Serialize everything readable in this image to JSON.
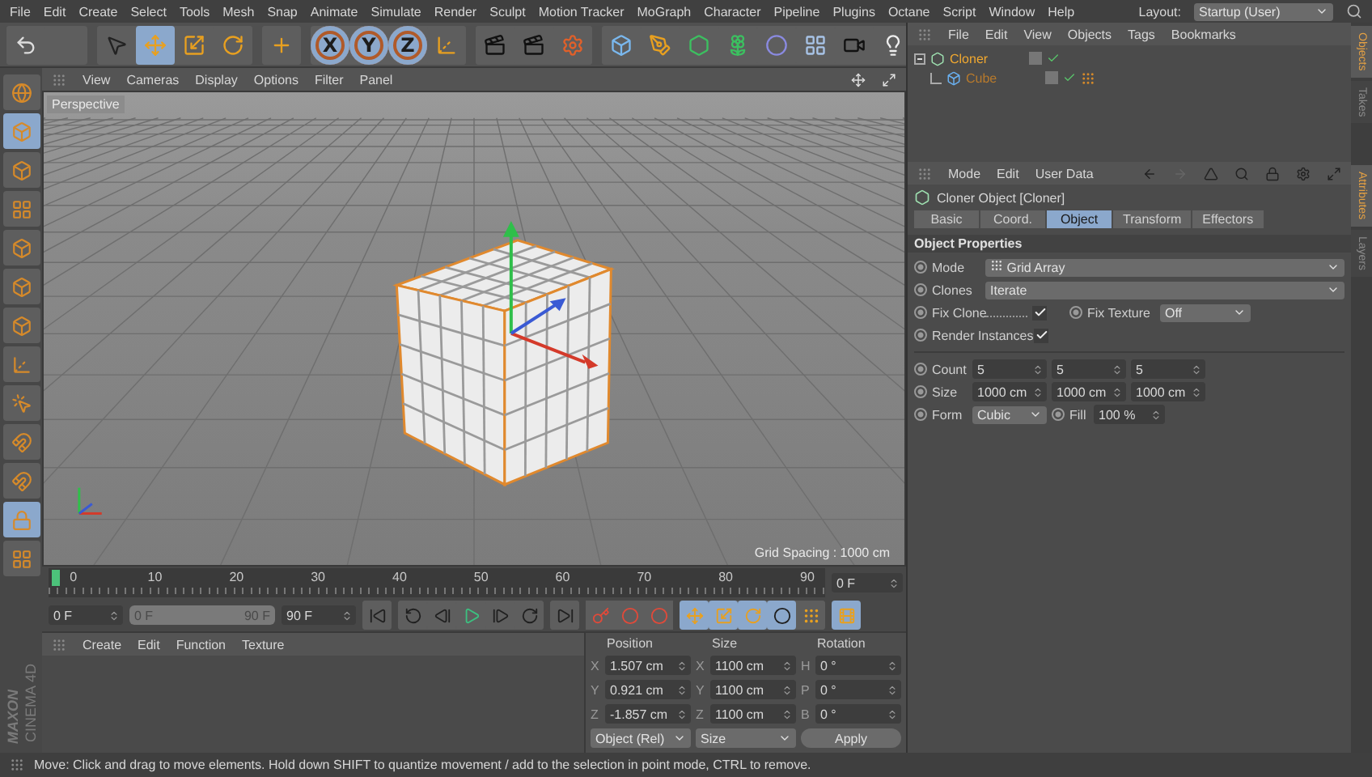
{
  "menu_bar": {
    "items": [
      "File",
      "Edit",
      "Create",
      "Select",
      "Tools",
      "Mesh",
      "Snap",
      "Animate",
      "Simulate",
      "Render",
      "Sculpt",
      "Motion Tracker",
      "MoGraph",
      "Character",
      "Pipeline",
      "Plugins",
      "Octane",
      "Script",
      "Window",
      "Help"
    ],
    "layout_label": "Layout:",
    "layout_value": "Startup (User)"
  },
  "toolbar": {
    "tools": [
      {
        "selected": false
      },
      {
        "selected": true
      },
      {
        "selected": false
      },
      {
        "selected": false
      },
      {
        "selected": false
      }
    ],
    "axes": [
      {
        "label": "X",
        "selected": true
      },
      {
        "label": "Y",
        "selected": true
      },
      {
        "label": "Z",
        "selected": true
      }
    ]
  },
  "left_palette": [
    {
      "selected": false
    },
    {
      "selected": true
    },
    {
      "selected": false
    },
    {
      "selected": false
    },
    {
      "selected": false
    },
    {
      "selected": false
    },
    {
      "selected": false
    },
    {
      "selected": false
    },
    {
      "selected": false
    },
    {
      "selected": false
    },
    {
      "selected": false
    },
    {
      "selected": true
    },
    {
      "selected": false
    }
  ],
  "viewport": {
    "menu": [
      "View",
      "Cameras",
      "Display",
      "Options",
      "Filter",
      "Panel"
    ],
    "camera": "Perspective",
    "grid_spacing": "Grid Spacing : 1000 cm"
  },
  "timeline": {
    "ticks": [
      "0",
      "10",
      "20",
      "30",
      "40",
      "50",
      "60",
      "70",
      "80",
      "90"
    ],
    "level": 0,
    "current_frame": "0 F"
  },
  "transport": {
    "level": 1,
    "start": "0 F",
    "range_start": "0 F",
    "range_end": "90 F",
    "end": "90 F"
  },
  "material_manager": {
    "menu": [
      "Create",
      "Edit",
      "Function",
      "Texture"
    ]
  },
  "logo": {
    "brand": "MAXON",
    "product": "CINEMA 4D"
  },
  "coordinates": {
    "headers": [
      "Position",
      "Size",
      "Rotation"
    ],
    "rows": [
      {
        "position": {
          "axis": "X",
          "value": "1.507 cm"
        },
        "size": {
          "axis": "X",
          "value": "1100 cm"
        },
        "rotation": {
          "axis": "H",
          "value": "0 °"
        }
      },
      {
        "position": {
          "axis": "Y",
          "value": "0.921 cm"
        },
        "size": {
          "axis": "Y",
          "value": "1100 cm"
        },
        "rotation": {
          "axis": "P",
          "value": "0 °"
        }
      },
      {
        "position": {
          "axis": "Z",
          "value": "-1.857 cm"
        },
        "size": {
          "axis": "Z",
          "value": "1100 cm"
        },
        "rotation": {
          "axis": "B",
          "value": "0 °"
        }
      }
    ],
    "mode": "Object (Rel)",
    "size_mode": "Size",
    "apply": "Apply"
  },
  "object_manager": {
    "menu": [
      "File",
      "Edit",
      "View",
      "Objects",
      "Tags",
      "Bookmarks"
    ],
    "objects": [
      {
        "name": "Cloner",
        "selected": true,
        "expanded": true,
        "children": [
          {
            "name": "Cube",
            "selected": false
          }
        ]
      }
    ],
    "side_tabs": [
      {
        "label": "Objects",
        "selected": true
      },
      {
        "label": "Takes",
        "selected": false
      }
    ]
  },
  "attributes": {
    "menu": [
      "Mode",
      "Edit",
      "User Data"
    ],
    "title": "Cloner Object [Cloner]",
    "tabs": [
      {
        "label": "Basic",
        "selected": false
      },
      {
        "label": "Coord.",
        "selected": false
      },
      {
        "label": "Object",
        "selected": true
      },
      {
        "label": "Transform",
        "selected": false
      },
      {
        "label": "Effectors",
        "selected": false
      }
    ],
    "section": "Object Properties",
    "mode": {
      "label": "Mode",
      "value": "Grid Array"
    },
    "clones": {
      "label": "Clones",
      "value": "Iterate"
    },
    "fix_clone": {
      "label": "Fix Clone",
      "checked": true
    },
    "fix_texture": {
      "label": "Fix Texture",
      "value": "Off"
    },
    "render_instances": {
      "label": "Render Instances",
      "checked": true
    },
    "count": {
      "label": "Count",
      "values": [
        "5",
        "5",
        "5"
      ]
    },
    "size": {
      "label": "Size",
      "values": [
        "1000 cm",
        "1000 cm",
        "1000 cm"
      ]
    },
    "form": {
      "label": "Form",
      "value": "Cubic"
    },
    "fill": {
      "label": "Fill",
      "value": "100 %"
    },
    "side_tabs": [
      {
        "label": "Attributes",
        "selected": true
      },
      {
        "label": "Layers",
        "selected": false
      }
    ]
  },
  "status_bar": "Move: Click and drag to move elements. Hold down SHIFT to quantize movement / add to the selection in point mode, CTRL to remove."
}
